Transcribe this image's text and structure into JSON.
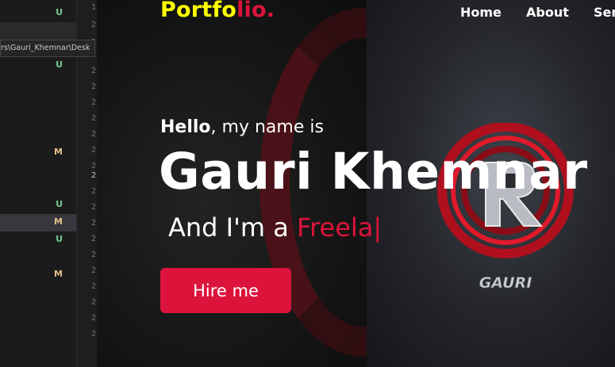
{
  "editor": {
    "path_tooltip": "rs\\Gauri_Khemnar\\Desk",
    "explorer_badges": [
      {
        "letter": "U",
        "kind": "u"
      },
      {
        "letter": "U",
        "kind": "u"
      },
      {
        "letter": "M",
        "kind": "m"
      },
      {
        "letter": "U",
        "kind": "u"
      },
      {
        "letter": "M",
        "kind": "m"
      },
      {
        "letter": "U",
        "kind": "u"
      },
      {
        "letter": "M",
        "kind": "m"
      }
    ],
    "line_numbers": [
      "1",
      "2",
      "2",
      "2",
      "2",
      "2",
      "2",
      "2",
      "2",
      "2",
      "2",
      "2",
      "2",
      "2",
      "2",
      "2",
      "2",
      "2",
      "2",
      "2",
      "2"
    ]
  },
  "site": {
    "brand": {
      "main": "Portfo",
      "accent": "lio."
    },
    "nav": [
      "Home",
      "About",
      "Serv"
    ],
    "hero": {
      "hello_bold": "Hello",
      "hello_rest": ", my name is",
      "name": "Gauri Khemnar",
      "role_prefix": "And I'm a ",
      "role_typed": "Freela",
      "caret": "|",
      "cta": "Hire me"
    },
    "logo_text": "GAURI",
    "colors": {
      "brand_yellow": "#ffff00",
      "accent_red": "#dc143c"
    }
  }
}
